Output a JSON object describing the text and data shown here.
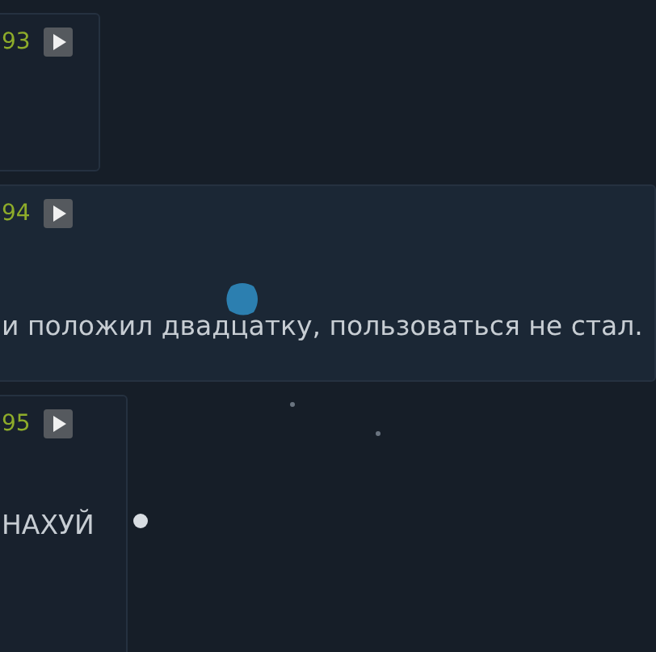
{
  "posts": [
    {
      "number": "93"
    },
    {
      "number": "94",
      "text": "и положил двадцатку, пользоваться не стал.",
      "sticker": true
    },
    {
      "number": "95",
      "text": "НАХУЙ"
    }
  ]
}
